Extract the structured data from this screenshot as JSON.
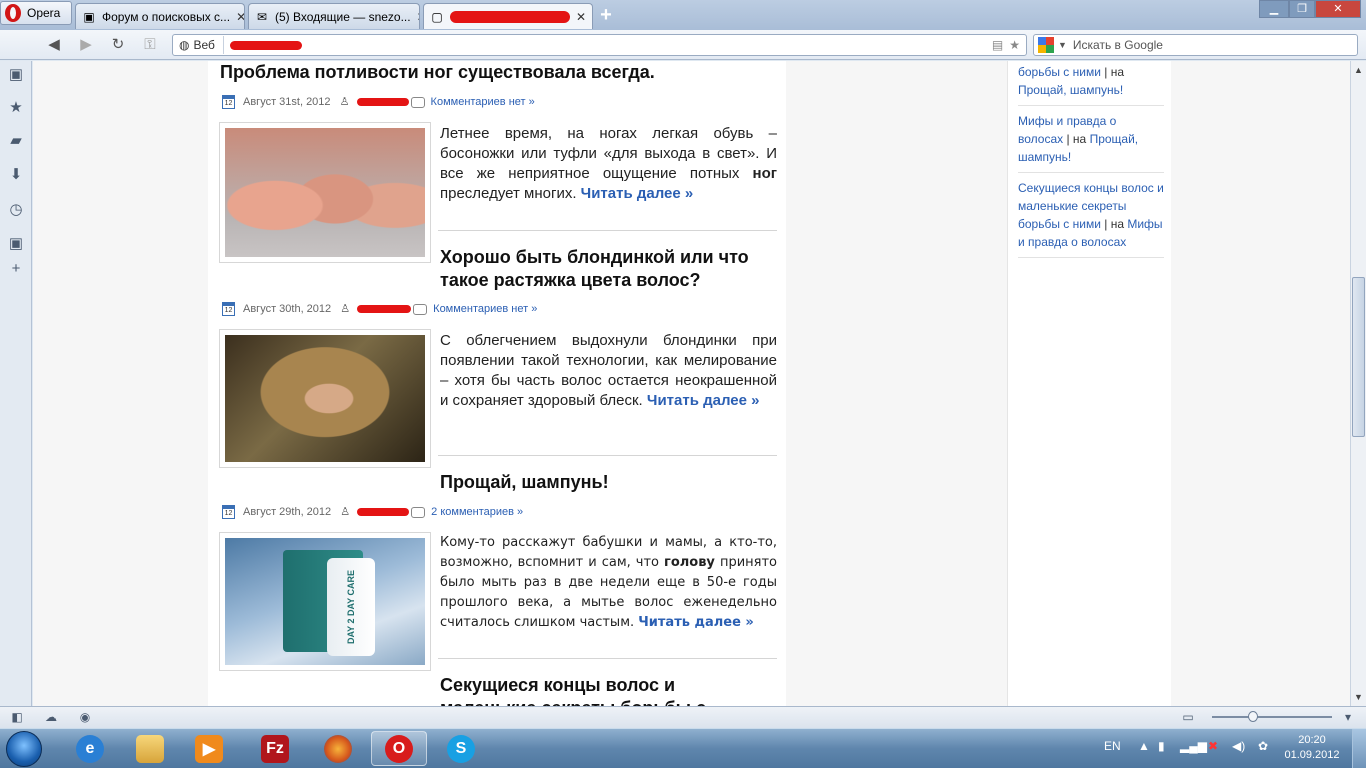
{
  "browser": {
    "menu_label": "Opera",
    "tabs": [
      {
        "label": "Форум о поисковых с...",
        "favicon": "forum-icon"
      },
      {
        "label": "(5) Входящие — snezo...",
        "favicon": "mail-icon"
      },
      {
        "label": "",
        "favicon": "page-icon"
      }
    ],
    "address": {
      "badge": "Веб",
      "url": ""
    },
    "search_placeholder": "Искать в Google"
  },
  "posts": [
    {
      "title": "Проблема потливости ног существовала всегда.",
      "date": "Август 31st, 2012",
      "comments": "Комментариев нет »",
      "excerpt_before": "Летнее время, на ногах легкая обувь – босоножки или туфли «для выхода в свет». И все же неприятное ощущение потных ",
      "excerpt_bold": "ног",
      "excerpt_after": " преследует многих. ",
      "readmore": "Читать далее »"
    },
    {
      "title": "Хорошо быть блондинкой или что такое растяжка цвета волос?",
      "date": "Август 30th, 2012",
      "comments": "Комментариев нет »",
      "excerpt": "С облегчением выдохнули блондинки при появлении такой технологии, как мелирование – хотя бы часть волос остается неокрашенной и сохраняет здоровый блеск. ",
      "readmore": "Читать далее »"
    },
    {
      "title": "Прощай, шампунь!",
      "date": "Август 29th, 2012",
      "comments": "2 комментариев »",
      "excerpt_before": "Кому-то расскажут бабушки и мамы, а кто-то, возможно, вспомнит и сам, что ",
      "excerpt_bold": "голову",
      "excerpt_after": " принято было мыть раз в две недели еще в 50-е годы прошлого века, а мытье волос еженедельно считалось слишком частым. ",
      "readmore": "Читать далее »",
      "image_text": "DAY 2 DAY CARE"
    },
    {
      "title": "Секущиеся концы волос и маленькие секреты борьбы с ними"
    }
  ],
  "sidebar": {
    "items": [
      {
        "link": "борьбы с ними",
        "sep": " | на ",
        "target": "Прощай, шампунь!"
      },
      {
        "link": "Мифы и правда о волосах",
        "sep": " | на ",
        "target": "Прощай, шампунь!"
      },
      {
        "link": "Секущиеся концы волос и маленькие секреты борьбы с ними",
        "sep": " | на ",
        "target": "Мифы и правда о волосах"
      }
    ]
  },
  "taskbar": {
    "language": "EN",
    "time": "20:20",
    "date": "01.09.2012"
  },
  "colors": {
    "link": "#2b5fb3",
    "title": "#111111",
    "redact": "#e41414"
  }
}
